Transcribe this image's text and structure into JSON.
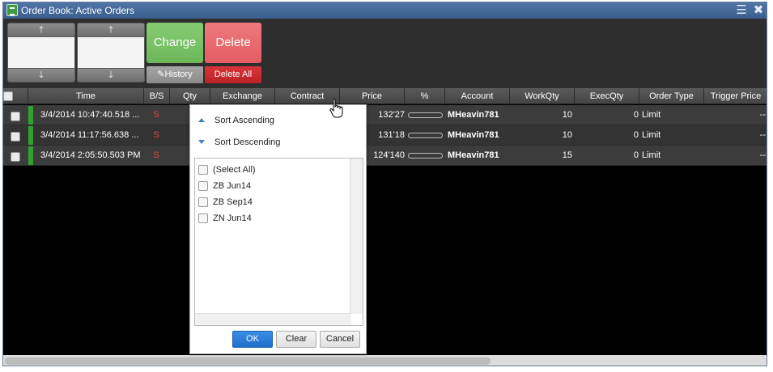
{
  "window": {
    "title": "Order Book: Active Orders",
    "icons": [
      "list-icon",
      "close-icon"
    ]
  },
  "toolbar": {
    "up_glyph": "🡑",
    "down_glyph": "🡓",
    "change_label": "Change",
    "delete_label": "Delete",
    "history_label": "History",
    "delete_all_label": "Delete All"
  },
  "columns": [
    "Time",
    "B/S",
    "Qty",
    "Exchange",
    "Contract",
    "Price",
    "%",
    "Account",
    "WorkQty",
    "ExecQty",
    "Order Type",
    "Trigger Price"
  ],
  "rows": [
    {
      "time": "3/4/2014 10:47:40.518 ...",
      "bs": "S",
      "price": "132'27",
      "account": "MHeavin781",
      "workqty": "10",
      "execqty": "0",
      "order_type": "Limit",
      "trigger": "--"
    },
    {
      "time": "3/4/2014 11:17:56.638 ...",
      "bs": "S",
      "price": "131'18",
      "account": "MHeavin781",
      "workqty": "10",
      "execqty": "0",
      "order_type": "Limit",
      "trigger": "--"
    },
    {
      "time": "3/4/2014 2:05:50.503 PM",
      "bs": "S",
      "price": "124'140",
      "account": "MHeavin781",
      "workqty": "15",
      "execqty": "0",
      "order_type": "Limit",
      "trigger": "--"
    }
  ],
  "filter_popup": {
    "sort_ascending": "Sort Ascending",
    "sort_descending": "Sort Descending",
    "items": [
      "(Select All)",
      "ZB Jun14",
      "ZB Sep14",
      "ZN Jun14"
    ],
    "ok_label": "OK",
    "clear_label": "Clear",
    "cancel_label": "Cancel"
  },
  "colors": {
    "buy_sell": "#e04545",
    "active_marker": "#2fa12f",
    "change": "#6db75a",
    "delete": "#e35c62"
  }
}
